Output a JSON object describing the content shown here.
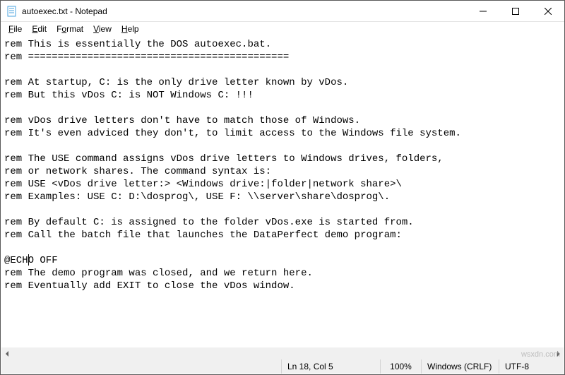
{
  "window": {
    "title": "autoexec.txt - Notepad"
  },
  "menu": {
    "file": "File",
    "edit": "Edit",
    "format": "Format",
    "view": "View",
    "help": "Help"
  },
  "content": "rem This is essentially the DOS autoexec.bat.\nrem ============================================\n\nrem At startup, C: is the only drive letter known by vDos.\nrem But this vDos C: is NOT Windows C: !!!\n\nrem vDos drive letters don't have to match those of Windows.\nrem It's even adviced they don't, to limit access to the Windows file system.\n\nrem The USE command assigns vDos drive letters to Windows drives, folders,\nrem or network shares. The command syntax is:\nrem USE <vDos drive letter:> <Windows drive:|folder|network share>\\\nrem Examples: USE C: D:\\dosprog\\, USE F: \\\\server\\share\\dosprog\\.\n\nrem By default C: is assigned to the folder vDos.exe is started from.\nrem Call the batch file that launches the DataPerfect demo program:\n\n@ECHO OFF\nrem The demo program was closed, and we return here.\nrem Eventually add EXIT to close the vDos window.",
  "status": {
    "position": "Ln 18, Col 5",
    "zoom": "100%",
    "eol": "Windows (CRLF)",
    "encoding": "UTF-8"
  },
  "watermark": "wsxdn.com"
}
